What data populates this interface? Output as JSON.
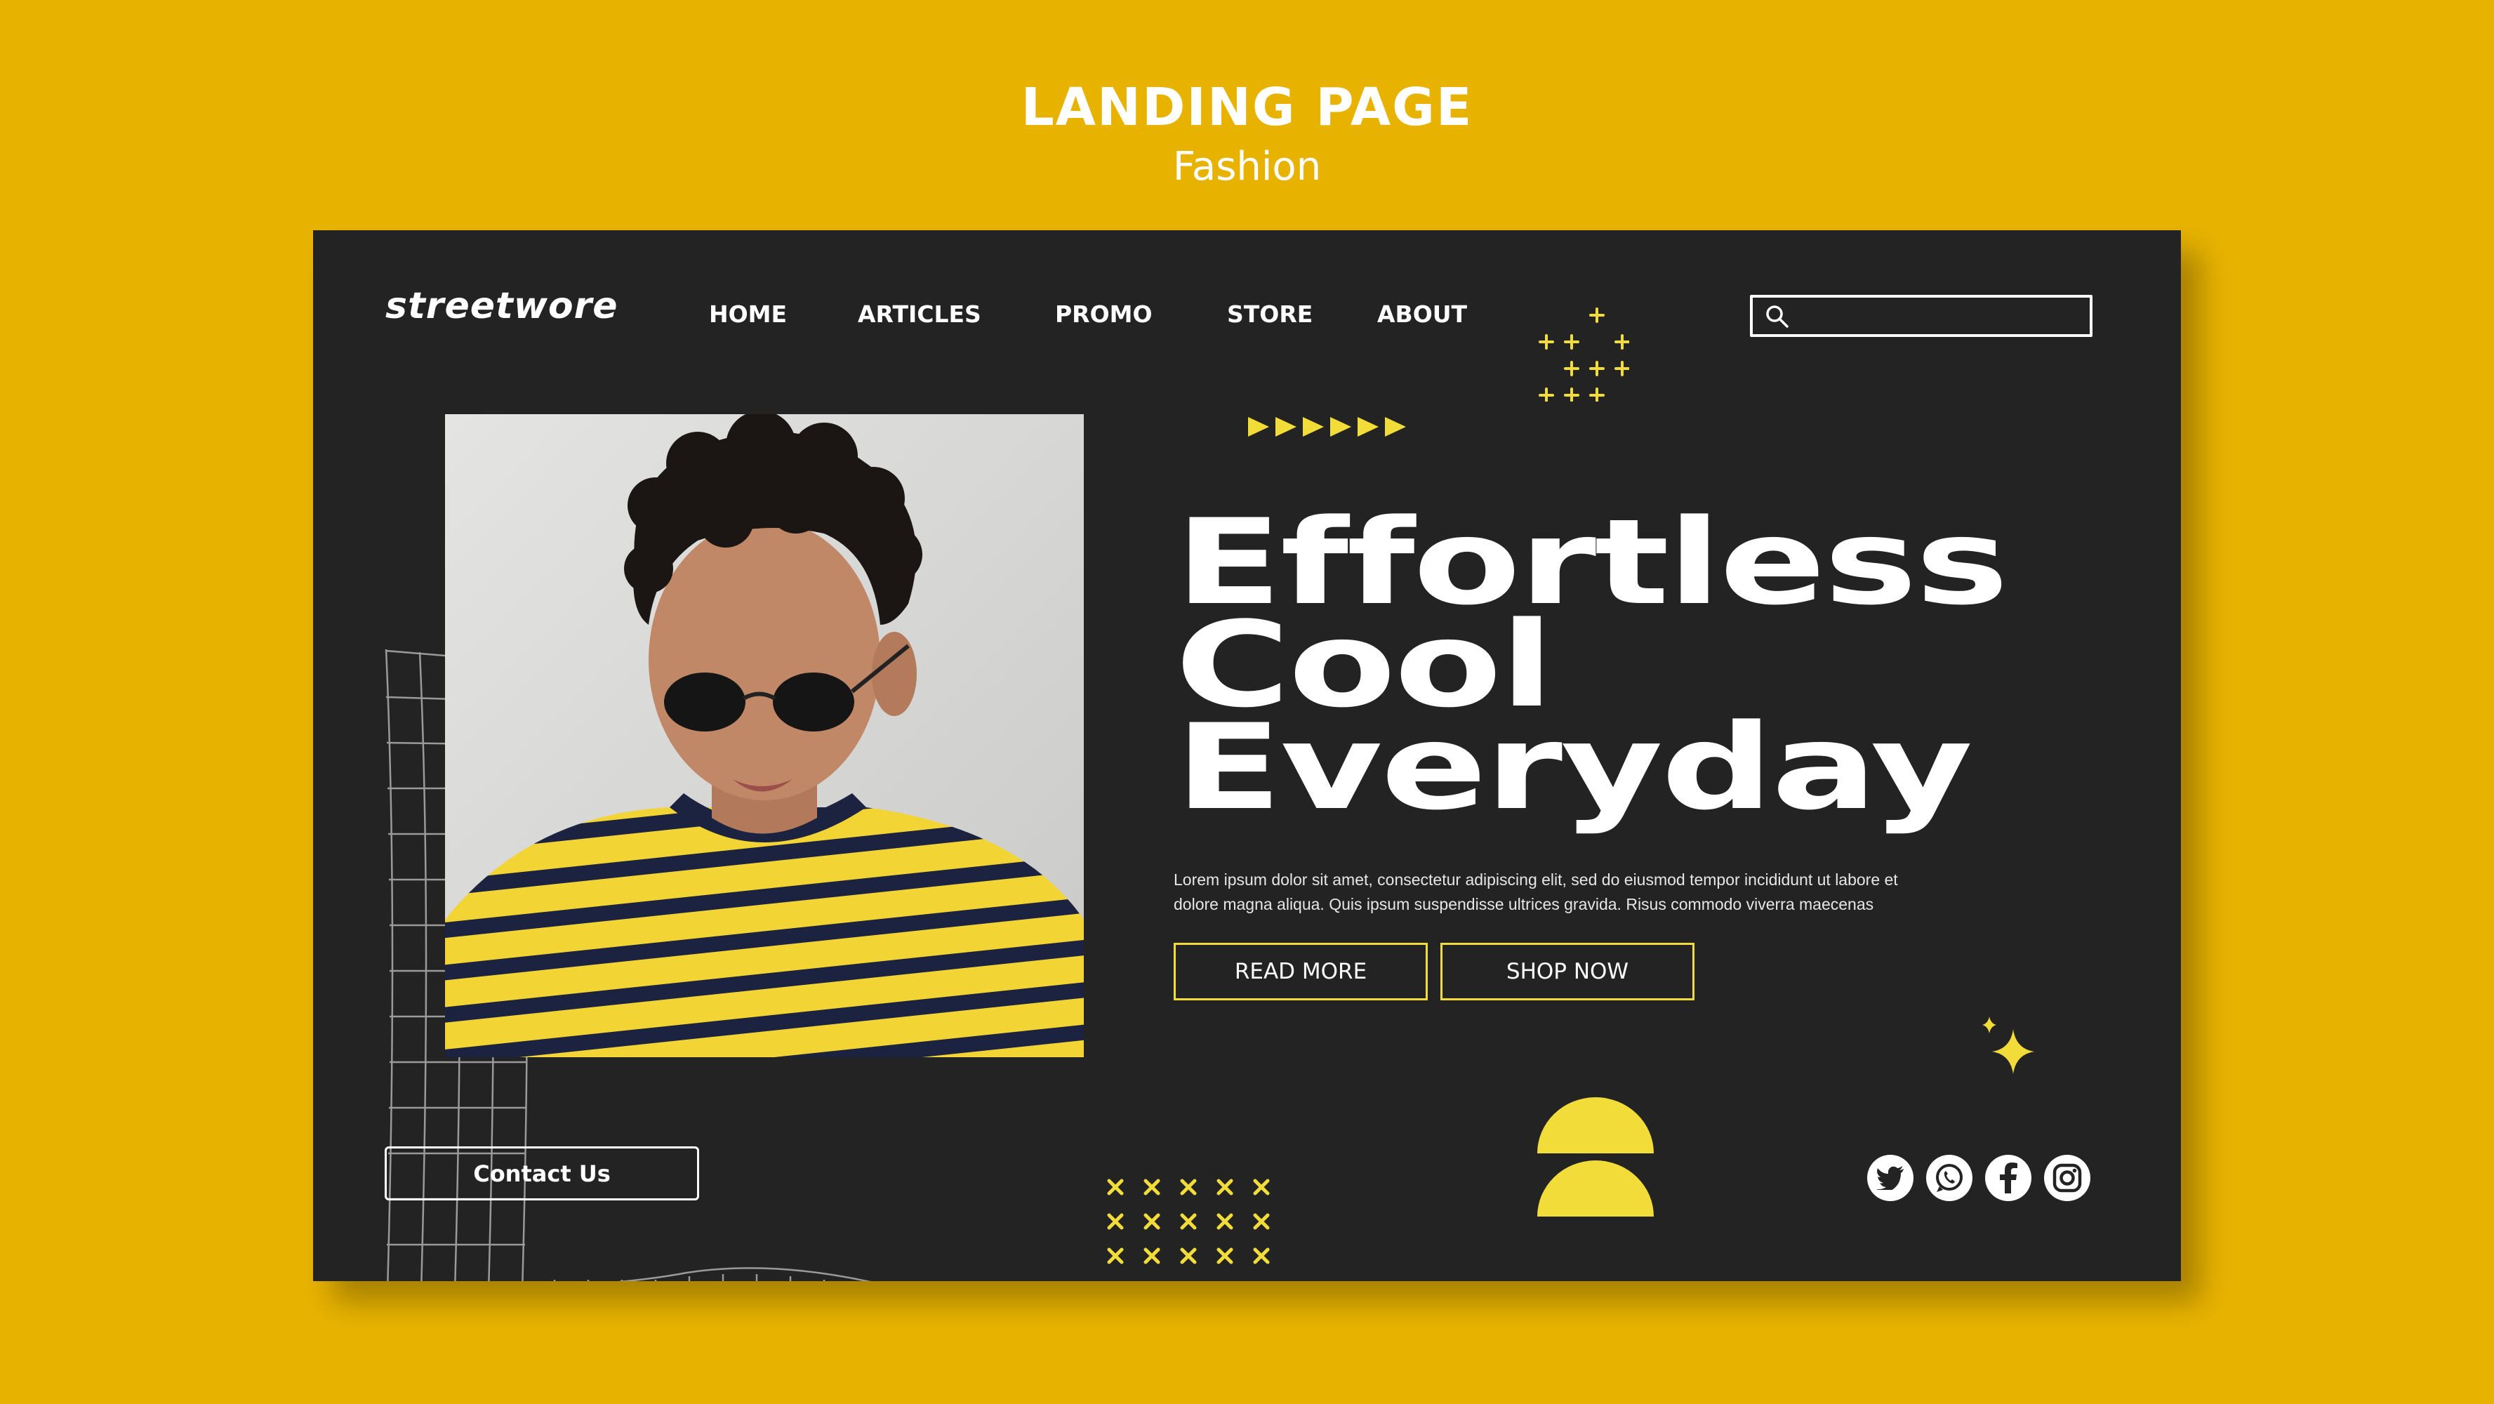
{
  "heading": {
    "title": "LANDING PAGE",
    "subtitle": "Fashion"
  },
  "brand": {
    "logo": "streetwore"
  },
  "nav": {
    "items": [
      {
        "label": "HOME"
      },
      {
        "label": "ARTICLES"
      },
      {
        "label": "PROMO"
      },
      {
        "label": "STORE"
      },
      {
        "label": "ABOUT"
      }
    ]
  },
  "search": {
    "placeholder": ""
  },
  "hero": {
    "headline_line1": "Effortless",
    "headline_line2": "Cool",
    "headline_line3": "Everyday",
    "body_line1": "Lorem ipsum dolor sit amet, consectetur adipiscing elit, sed do eiusmod tempor incididunt ut labore et",
    "body_line2": "dolore magna aliqua. Quis ipsum suspendisse ultrices gravida. Risus commodo viverra maecenas",
    "read_more": "READ MORE",
    "shop_now": "SHOP NOW"
  },
  "footer": {
    "contact": "Contact Us"
  },
  "social": [
    "twitter-icon",
    "whatsapp-icon",
    "facebook-icon",
    "instagram-icon"
  ],
  "colors": {
    "background": "#E8B300",
    "card": "#232323",
    "accent": "#F2DC3A",
    "text": "#FFFFFF"
  }
}
